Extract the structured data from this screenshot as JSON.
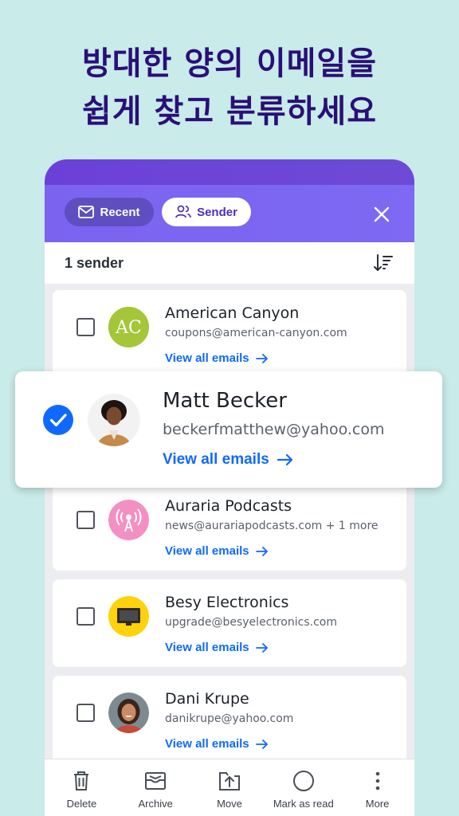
{
  "headline": {
    "line1": "방대한 양의 이메일을",
    "line2": "쉽게 찾고 분류하세요"
  },
  "filters": {
    "recent": {
      "label": "Recent",
      "icon": "mail-icon"
    },
    "sender": {
      "label": "Sender",
      "icon": "people-icon",
      "selected": true
    },
    "close_icon": "close-icon"
  },
  "results": {
    "count_label": "1 sender",
    "sort_icon": "sort-icon"
  },
  "senders": [
    {
      "name": "American Canyon",
      "email": "coupons@american-canyon.com",
      "link": "View all emails",
      "checked": false,
      "avatar_text": "AC",
      "avatar_color": "#a4c639"
    },
    {
      "name": "Matt Becker",
      "email": "beckerfmatthew@yahoo.com",
      "link": "View all emails",
      "checked": true
    },
    {
      "name": "Auraria Podcasts",
      "email": "news@aurariapodcasts.com + 1 more",
      "link": "View all emails",
      "checked": false,
      "avatar_color": "#f48fc4"
    },
    {
      "name": "Besy Electronics",
      "email": "upgrade@besyelectronics.com",
      "link": "View all emails",
      "checked": false,
      "avatar_color": "#ffd20a"
    },
    {
      "name": "Dani Krupe",
      "email": "danikrupe@yahoo.com",
      "link": "View all emails",
      "checked": false
    }
  ],
  "toolbar": {
    "delete": "Delete",
    "archive": "Archive",
    "move": "Move",
    "mark_read": "Mark as read",
    "more": "More"
  },
  "colors": {
    "background": "#c9ebe9",
    "headline": "#2a0f78",
    "accent": "#0f69ff",
    "filter_bar": "#7b63ef"
  }
}
